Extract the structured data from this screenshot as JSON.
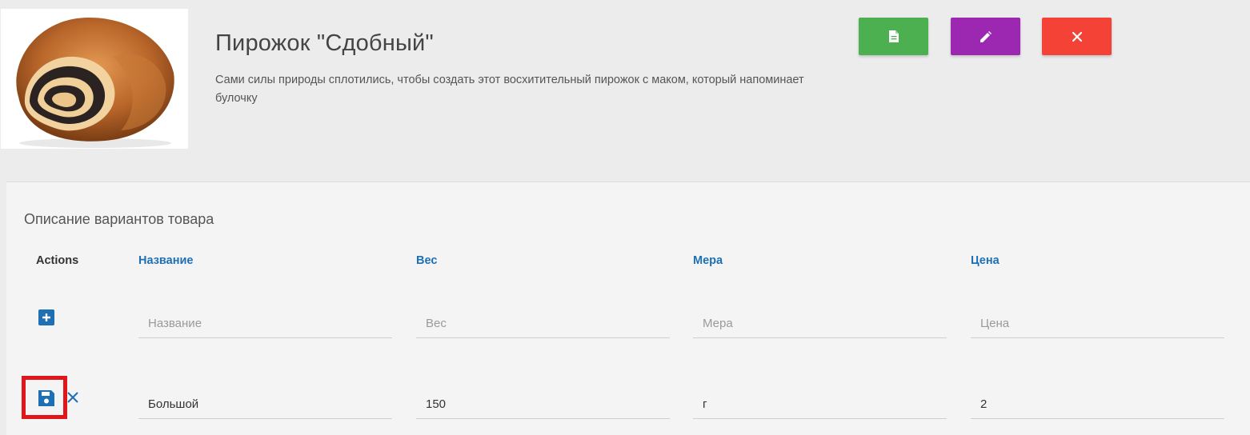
{
  "product": {
    "title": "Пирожок \"Сдобный\"",
    "description": "Сами силы природы сплотились, чтобы создать этот восхитительный пирожок с маком, который напоминает булочку",
    "image_icon": "poppy-seed-roll-image"
  },
  "header_buttons": [
    {
      "icon": "document-icon",
      "color": "#4caf50"
    },
    {
      "icon": "pencil-icon",
      "color": "#9c27b0"
    },
    {
      "icon": "close-icon",
      "color": "#f44336"
    }
  ],
  "variants": {
    "title": "Описание вариантов товара",
    "columns": {
      "actions": "Actions",
      "name": "Название",
      "weight": "Вес",
      "measure": "Мера",
      "price": "Цена"
    },
    "new_row": {
      "placeholders": {
        "name": "Название",
        "weight": "Вес",
        "measure": "Мера",
        "price": "Цена"
      }
    },
    "edit_row": {
      "name": "Большой",
      "weight": "150",
      "measure": "г",
      "price": "2"
    }
  },
  "colors": {
    "accent_blue": "#1e6fb3",
    "highlight_red": "#e0161b"
  }
}
